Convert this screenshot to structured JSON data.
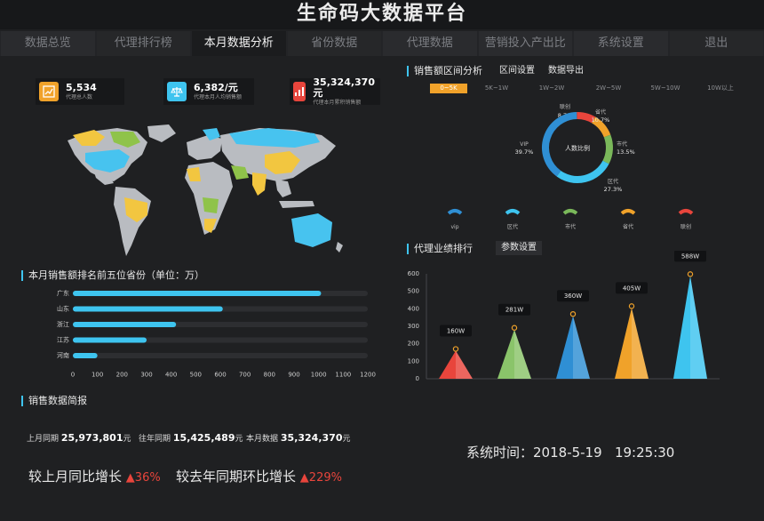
{
  "header": {
    "title": "生命码大数据平台"
  },
  "nav": {
    "tabs": [
      {
        "label": "数据总览",
        "state": "normal"
      },
      {
        "label": "代理排行榜",
        "state": "dim"
      },
      {
        "label": "本月数据分析",
        "state": "active"
      },
      {
        "label": "省份数据",
        "state": "dim"
      },
      {
        "label": "代理数据",
        "state": "normal"
      },
      {
        "label": "营销投入产出比",
        "state": "normal"
      },
      {
        "label": "系统设置",
        "state": "normal"
      },
      {
        "label": "退出",
        "state": "dim"
      }
    ]
  },
  "stats": [
    {
      "value": "5,534",
      "label": "代理总人数",
      "color": "#f0a22a",
      "icon": "chart-icon"
    },
    {
      "value": "6,382/元",
      "label": "代理本月人均销售额",
      "color": "#3ec4ef",
      "icon": "scale-icon"
    },
    {
      "value": "35,324,370元",
      "label": "代理本月累积销售额",
      "color": "#e8453c",
      "icon": "bar-chart-icon"
    }
  ],
  "sales_interval": {
    "title": "销售额区间分析",
    "buttons": {
      "interval_settings": "区间设置",
      "data_export": "数据导出"
    },
    "ranges": [
      "0~5K",
      "5K~1W",
      "1W~2W",
      "2W~5W",
      "5W~10W",
      "10W以上"
    ],
    "active_range": 0,
    "donut_center": "人数比例",
    "slices": [
      {
        "name": "vip",
        "pct": "39.7%",
        "value": 39.7,
        "color": "#2f8fd4"
      },
      {
        "name": "区代",
        "pct": "27.3%",
        "value": 27.3,
        "color": "#3ec4ef"
      },
      {
        "name": "市代",
        "pct": "13.5%",
        "value": 13.5,
        "color": "#7ab85a"
      },
      {
        "name": "省代",
        "pct": "10.7%",
        "value": 10.7,
        "color": "#f0a22a"
      },
      {
        "name": "联创",
        "pct": "8.7%",
        "value": 8.7,
        "color": "#e8453c"
      }
    ]
  },
  "province_rank": {
    "title": "本月销售额排名前五位省份（单位：万）",
    "chart_data": {
      "type": "bar",
      "categories": [
        "广东",
        "山东",
        "浙江",
        "江苏",
        "河南"
      ],
      "values": [
        1010,
        610,
        420,
        300,
        100
      ],
      "xlim": [
        0,
        1200
      ],
      "ticks": [
        "0",
        "100",
        "200",
        "300",
        "400",
        "500",
        "600",
        "700",
        "800",
        "900",
        "1000",
        "1100",
        "1200"
      ],
      "bar_color": "#3ec4ef",
      "track_color": "#2d2e31"
    }
  },
  "agent_rank": {
    "title": "代理业绩排行",
    "settings_button": "参数设置",
    "chart_data": {
      "type": "bar",
      "values": [
        160,
        281,
        360,
        405,
        588
      ],
      "labels": [
        "160W",
        "281W",
        "360W",
        "405W",
        "588W"
      ],
      "colors": [
        "#e8453c",
        "#8ac46a",
        "#2f8fd4",
        "#f0a22a",
        "#3ec4ef"
      ],
      "ylim": [
        0,
        600
      ],
      "yticks": [
        "0",
        "100",
        "200",
        "300",
        "400",
        "500",
        "600"
      ]
    }
  },
  "brief": {
    "title": "销售数据简报",
    "items": [
      {
        "label": "上月同期",
        "value": "25,973,801",
        "unit": "元"
      },
      {
        "label": "往年同期",
        "value": "15,425,489",
        "unit": "元"
      },
      {
        "label": "本月数据",
        "value": "35,324,370",
        "unit": "元"
      }
    ],
    "growth": [
      {
        "label": "较上月同比增长",
        "pct": "36%"
      },
      {
        "label": "较去年同期环比增长",
        "pct": "229%"
      }
    ]
  },
  "system_time": {
    "label": "系统时间：",
    "date": "2018-5-19",
    "time": "19:25:30"
  },
  "map": {
    "colors": {
      "land": "#b9bcc1",
      "yellow": "#f2c640",
      "blue": "#47c3ef",
      "green": "#8fc34a"
    }
  }
}
